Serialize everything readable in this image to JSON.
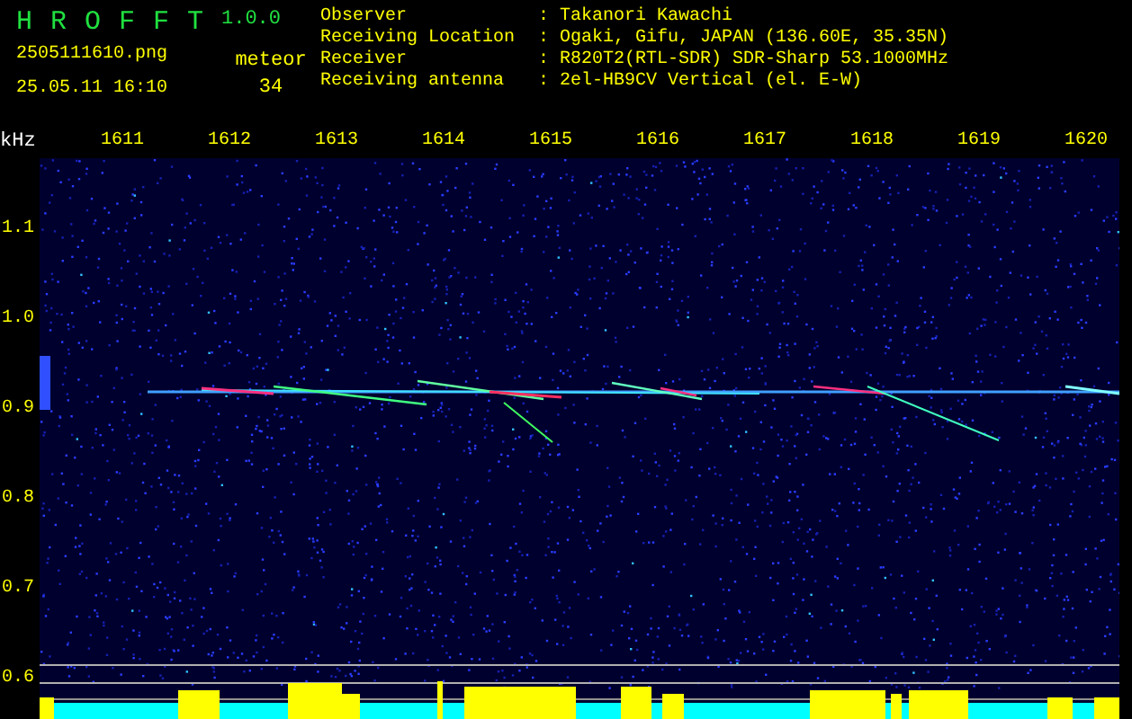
{
  "app": {
    "title": "H R O F F T",
    "version": "1.0.0"
  },
  "file": {
    "filename": "2505111610.png",
    "datetime": "25.05.11 16:10"
  },
  "meteor": {
    "label": "meteor",
    "count": "34"
  },
  "info": [
    {
      "key": "Observer",
      "separator": ":",
      "value": "Takanori Kawachi"
    },
    {
      "key": "Receiving Location",
      "separator": ":",
      "value": "Ogaki, Gifu, JAPAN (136.60E, 35.35N)"
    },
    {
      "key": "Receiver",
      "separator": ":",
      "value": "R820T2(RTL-SDR) SDR-Sharp 53.1000MHz"
    },
    {
      "key": "Receiving antenna",
      "separator": ":",
      "value": "2el-HB9CV Vertical (el. E-W)"
    }
  ],
  "spectrogram": {
    "y_unit": "kHz",
    "x_ticks": [
      "1611",
      "1612",
      "1613",
      "1614",
      "1615",
      "1616",
      "1617",
      "1618",
      "1619",
      "1620"
    ],
    "y_ticks": [
      "1.1",
      "1.0",
      "0.9",
      "0.8",
      "0.7",
      "0.6"
    ]
  }
}
